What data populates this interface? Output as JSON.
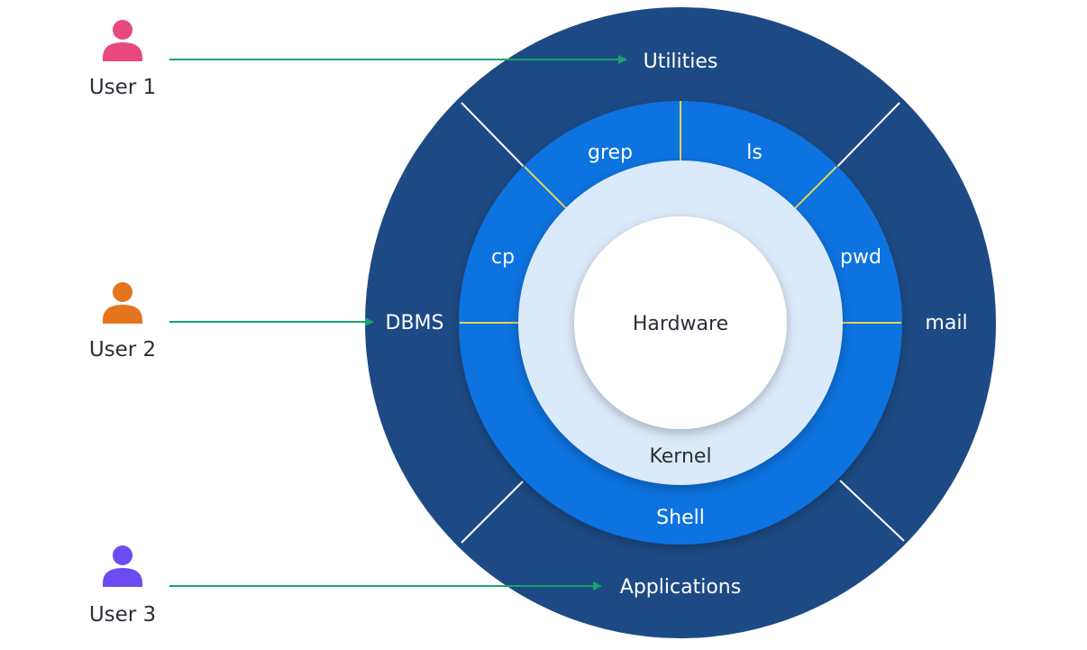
{
  "users": [
    {
      "label": "User 1",
      "color": "#e8487d"
    },
    {
      "label": "User 2",
      "color": "#e5741f"
    },
    {
      "label": "User 3",
      "color": "#6c4cf0"
    }
  ],
  "rings": {
    "outer": {
      "color": "#1d4a85",
      "segments": [
        "Utilities",
        "mail",
        "Applications",
        "DBMS"
      ]
    },
    "shell": {
      "label": "Shell",
      "color": "#0f73e0",
      "segments": [
        "grep",
        "ls",
        "pwd",
        "cp"
      ]
    },
    "kernel": {
      "label": "Kernel",
      "color": "#dbeafb"
    },
    "hardware": {
      "label": "Hardware",
      "color": "#ffffff"
    }
  },
  "colors": {
    "arrow": "#1aa36b",
    "outer_divider": "#ffffff",
    "shell_divider": "#e6d35a"
  }
}
